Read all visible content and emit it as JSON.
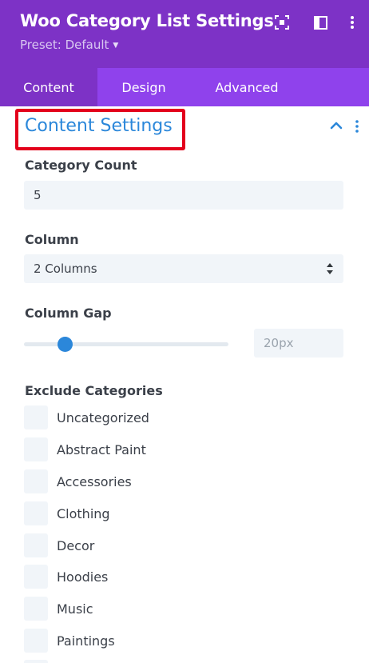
{
  "header": {
    "title": "Woo Category List Settings",
    "preset_label": "Preset: Default",
    "icons": [
      "expand-icon",
      "sidebar-layout-icon",
      "more-vertical-icon"
    ]
  },
  "tabs": [
    {
      "label": "Content",
      "active": true
    },
    {
      "label": "Design",
      "active": false
    },
    {
      "label": "Advanced",
      "active": false
    }
  ],
  "section": {
    "title": "Content Settings",
    "expanded": true
  },
  "fields": {
    "category_count": {
      "label": "Category Count",
      "value": "5"
    },
    "column": {
      "label": "Column",
      "value": "2 Columns"
    },
    "column_gap": {
      "label": "Column Gap",
      "value": "20px",
      "slider_fraction": 0.2
    }
  },
  "exclude": {
    "label": "Exclude Categories",
    "items": [
      "Uncategorized",
      "Abstract Paint",
      "Accessories",
      "Clothing",
      "Decor",
      "Hoodies",
      "Music",
      "Paintings"
    ]
  },
  "colors": {
    "header_bg": "#7d32c6",
    "tabs_bg": "#8f42ec",
    "accent_blue": "#2b87da",
    "highlight_red": "#e3001b"
  }
}
